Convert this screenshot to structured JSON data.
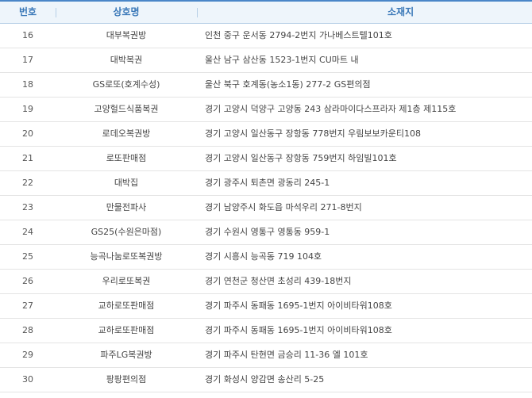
{
  "header": {
    "no": "번호",
    "name": "상호명",
    "address": "소재지"
  },
  "rows": [
    {
      "no": "16",
      "name": "대부복권방",
      "address": "인천 중구 운서동 2794-2번지 가나베스트텔101호"
    },
    {
      "no": "17",
      "name": "대박복권",
      "address": "울산 남구 삼산동 1523-1번지 CU마트 내"
    },
    {
      "no": "18",
      "name": "GS로또(호계수성)",
      "address": "울산 북구 호계동(농소1동) 277-2 GS편의점"
    },
    {
      "no": "19",
      "name": "고양헐드식품복권",
      "address": "경기 고양시 덕양구 고양동 243 삼라마이다스프라자 제1층 제115호"
    },
    {
      "no": "20",
      "name": "로데오복권방",
      "address": "경기 고양시 일산동구 장항동 778번지 우림보보카운티108"
    },
    {
      "no": "21",
      "name": "로또판매점",
      "address": "경기 고양시 일산동구 장항동 759번지 하임빌101호"
    },
    {
      "no": "22",
      "name": "대박집",
      "address": "경기 광주시 퇴촌면 광동리 245-1"
    },
    {
      "no": "23",
      "name": "만물전파사",
      "address": "경기 남양주시 화도읍 마석우리 271-8번지"
    },
    {
      "no": "24",
      "name": "GS25(수원은마점)",
      "address": "경기 수원시 영통구 영통동 959-1"
    },
    {
      "no": "25",
      "name": "능곡나눔로또복권방",
      "address": "경기 시흥시 능곡동 719 104호"
    },
    {
      "no": "26",
      "name": "우리로또복권",
      "address": "경기 연천군 청산면 초성리 439-18번지"
    },
    {
      "no": "27",
      "name": "교하로또판매점",
      "address": "경기 파주시 동패동 1695-1번지 아이비타워108호"
    },
    {
      "no": "28",
      "name": "교하로또판매점",
      "address": "경기 파주시 동패동 1695-1번지 아이비타워108호"
    },
    {
      "no": "29",
      "name": "파주LG복권방",
      "address": "경기 파주시 탄현면 금승리 11-36 엘 101호"
    },
    {
      "no": "30",
      "name": "팡팡편의점",
      "address": "경기 화성시 양감면 송산리 5-25"
    }
  ]
}
